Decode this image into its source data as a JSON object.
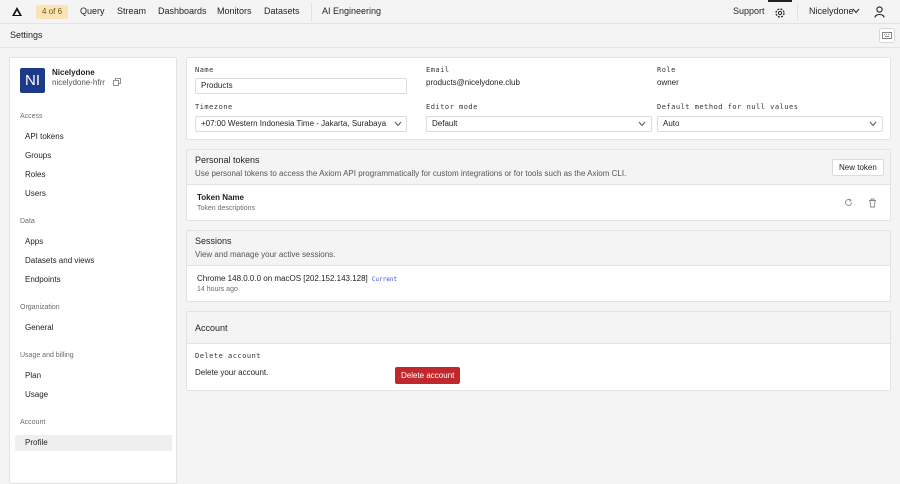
{
  "nav": {
    "badge": "4 of 6",
    "links": [
      "Query",
      "Stream",
      "Dashboards",
      "Monitors",
      "Datasets",
      "AI Engineering"
    ],
    "support": "Support",
    "org_menu": "Nicelydone"
  },
  "settings_title": "Settings",
  "sidebar": {
    "avatar": "NI",
    "org_name": "Nicelydone",
    "org_slug": "nicelydone-hfrr",
    "sections": {
      "access": {
        "label": "Access",
        "items": [
          "API tokens",
          "Groups",
          "Roles",
          "Users"
        ]
      },
      "data": {
        "label": "Data",
        "items": [
          "Apps",
          "Datasets and views",
          "Endpoints"
        ]
      },
      "organization": {
        "label": "Organization",
        "items": [
          "General"
        ]
      },
      "billing": {
        "label": "Usage and billing",
        "items": [
          "Plan",
          "Usage"
        ]
      },
      "account": {
        "label": "Account",
        "items": [
          "Profile"
        ]
      }
    }
  },
  "profile": {
    "name_label": "Name",
    "name_value": "Products",
    "email_label": "Email",
    "email_value": "products@nicelydone.club",
    "role_label": "Role",
    "role_value": "owner",
    "timezone_label": "Timezone",
    "timezone_value": "+07:00 Western Indonesia Time - Jakarta, Surabaya",
    "editor_label": "Editor mode",
    "editor_value": "Default",
    "null_label": "Default method for null values",
    "null_value": "Auto"
  },
  "tokens": {
    "title": "Personal tokens",
    "description": "Use personal tokens to access the Axiom API programmatically for custom integrations or for tools such as the Axiom CLI.",
    "new_button": "New token",
    "row_name": "Token Name",
    "row_desc": "Token descriptions"
  },
  "sessions": {
    "title": "Sessions",
    "description": "View and manage your active sessions.",
    "row_title": "Chrome 148.0.0.0 on macOS [202.152.143.128]",
    "row_badge": "Current",
    "row_time": "14 hours ago"
  },
  "account": {
    "title": "Account",
    "delete_label": "Delete account",
    "delete_desc": "Delete your account.",
    "delete_button": "Delete account"
  },
  "colors": {
    "accent": "#1d3a8a",
    "danger": "#c0282d",
    "badge_bg": "#f9e4b8"
  }
}
